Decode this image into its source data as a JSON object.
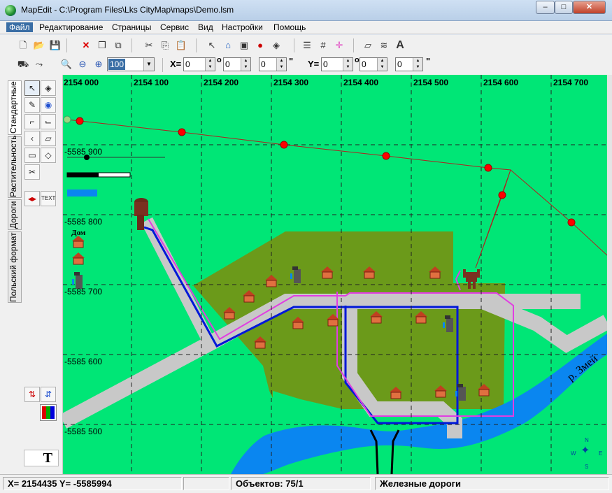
{
  "window": {
    "title": "MapEdit - C:\\Program Files\\Lks CityMap\\maps\\Demo.lsm",
    "minimize": "–",
    "maximize": "□",
    "close": "✕"
  },
  "menu": [
    "Файл",
    "Редактирование",
    "Страницы",
    "Сервис",
    "Вид",
    "Настройки",
    "Помощь"
  ],
  "zoom": {
    "value": "100"
  },
  "coords": {
    "x_label": "X=",
    "y_label": "Y=",
    "x_deg": "0",
    "x_min": "0",
    "x_sec": "0",
    "y_deg": "0",
    "y_min": "0",
    "y_sec": "0",
    "deg_mark": "o",
    "sec_mark": "\""
  },
  "side_tabs": [
    "Стандартные",
    "Растительность",
    "Дороги",
    "Польский формат"
  ],
  "tools": {
    "text_button": "TEXT",
    "text_tool": "T"
  },
  "map": {
    "x_ticks": [
      "2154 000",
      "2154 100",
      "2154 200",
      "2154 300",
      "2154 400",
      "2154 500",
      "2154 600",
      "2154 700"
    ],
    "y_ticks": [
      "-5585 900",
      "-5585 800",
      "-5585 700",
      "-5585 600",
      "-5585 500"
    ],
    "legend_house_label": "Дом",
    "river_label": "р. Змей",
    "compass": {
      "n": "N",
      "s": "S",
      "w": "W",
      "e": "E"
    },
    "colors": {
      "background": "#00e676",
      "forest": "#6b9a1a",
      "road": "#c8c8c8",
      "water": "#0a86f0",
      "pipe_blue": "#0018d8",
      "pipe_magenta": "#e13ee1",
      "power_line": "#b02020",
      "node": "#ff0000"
    }
  },
  "status": {
    "coords": "X= 2154435  Y= -5585994",
    "objects": "Объектов: 75/1",
    "layer": "Железные дороги"
  }
}
